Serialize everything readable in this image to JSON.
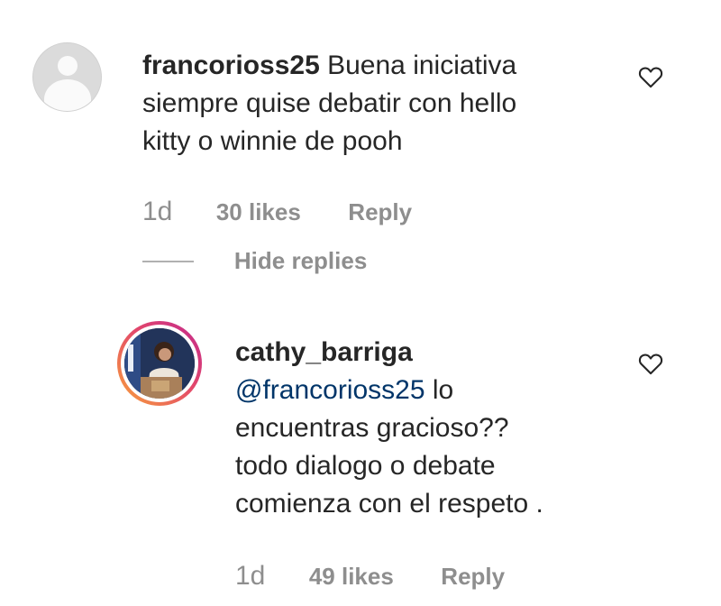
{
  "comments": [
    {
      "username": "francorioss25",
      "text_line1": "Buena iniciativa",
      "text_line2": "siempre quise debatir con hello",
      "text_line3": "kitty o winnie de pooh",
      "time": "1d",
      "likes": "30 likes",
      "reply_label": "Reply",
      "avatar_icon": "default-user-icon"
    }
  ],
  "hide_replies_label": "Hide replies",
  "replies": [
    {
      "username": "cathy_barriga",
      "mention": "@francorioss25",
      "text_line1_rest": " lo",
      "text_line2": "encuentras gracioso??",
      "text_line3": "todo dialogo o debate",
      "text_line4": "comienza con el respeto .",
      "time": "1d",
      "likes": "49 likes",
      "reply_label": "Reply",
      "avatar_icon": "profile-photo"
    }
  ],
  "icons": {
    "like": "heart-outline-icon"
  },
  "colors": {
    "text": "#262626",
    "meta": "#8e8e8e",
    "mention": "#003569",
    "story_ring": "#e3486a"
  }
}
